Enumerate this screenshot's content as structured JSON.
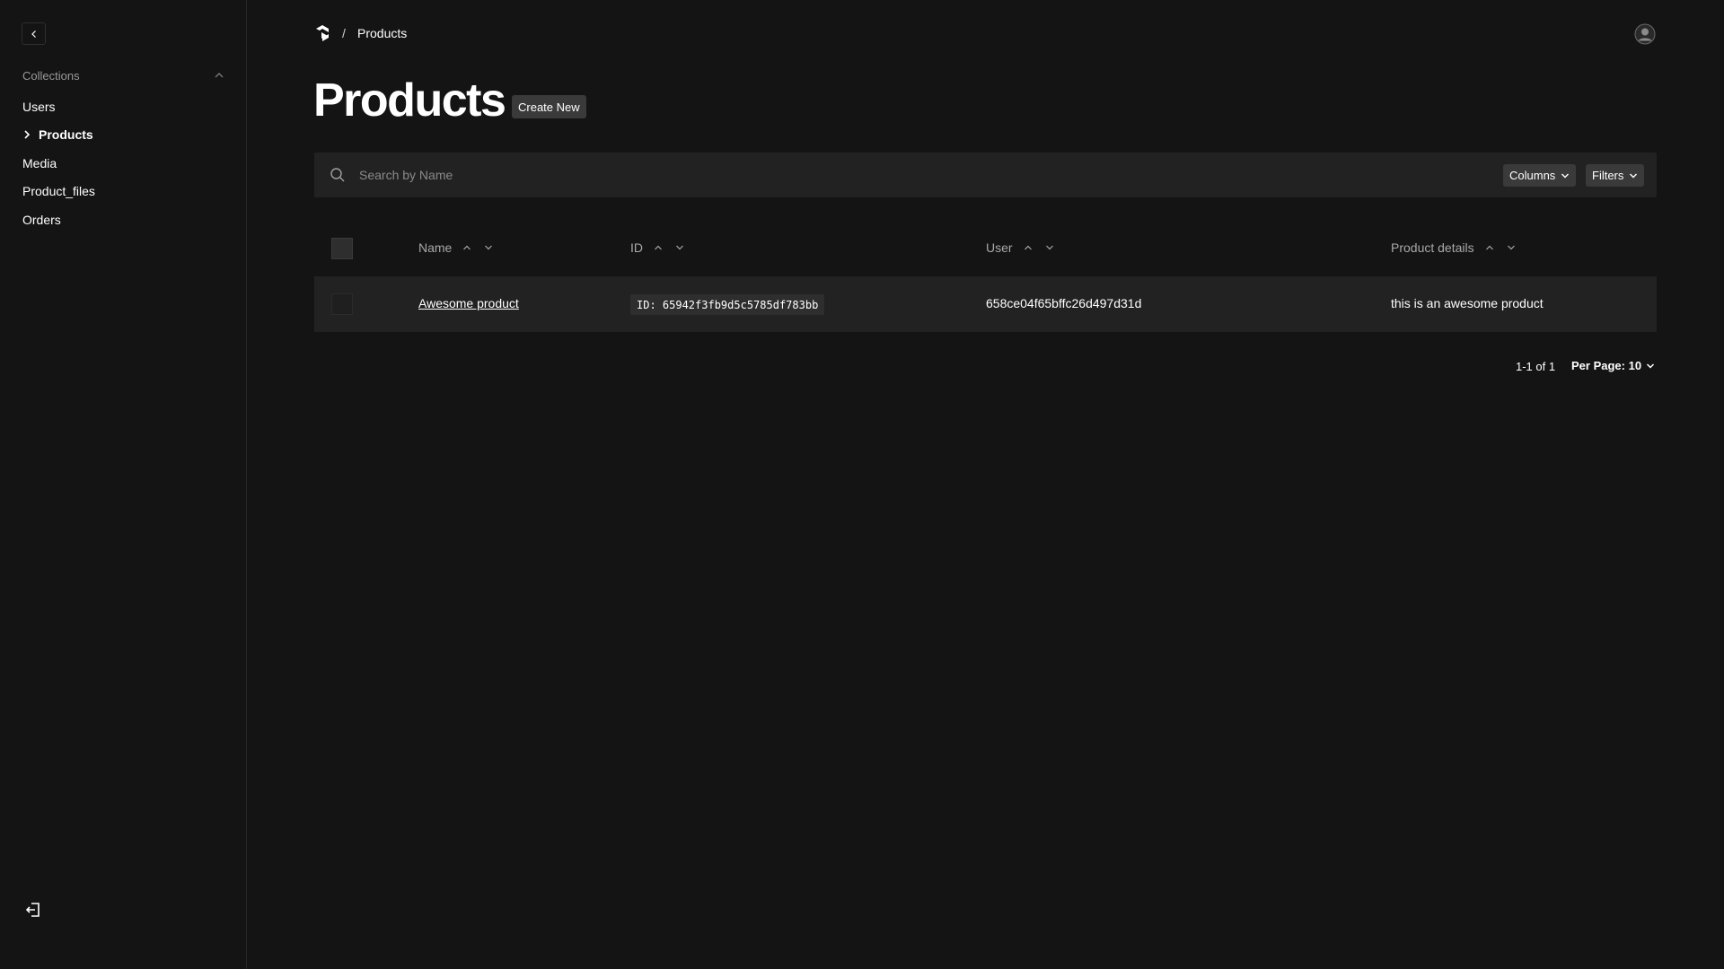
{
  "sidebar": {
    "section_label": "Collections",
    "items": [
      {
        "label": "Users"
      },
      {
        "label": "Products"
      },
      {
        "label": "Media"
      },
      {
        "label": "Product_files"
      },
      {
        "label": "Orders"
      }
    ],
    "active_item": "Products"
  },
  "breadcrumb": {
    "separator": "/",
    "current": "Products"
  },
  "page": {
    "title": "Products",
    "create_label": "Create New"
  },
  "search": {
    "placeholder": "Search by Name",
    "value": ""
  },
  "controls": {
    "columns_label": "Columns",
    "filters_label": "Filters"
  },
  "table": {
    "columns": [
      "Name",
      "ID",
      "User",
      "Product details"
    ],
    "rows": [
      {
        "name": "Awesome product",
        "id": "ID: 65942f3fb9d5c5785df783bb",
        "user": "658ce04f65bffc26d497d31d",
        "details": "this is an awesome product"
      }
    ]
  },
  "pagination": {
    "count_text": "1-1 of 1",
    "per_page_text": "Per Page: 10"
  },
  "icons": {
    "collapse": "chevron-left-icon",
    "section_toggle": "chevron-up-icon",
    "active_marker": "chevron-right-icon",
    "logout": "logout-icon",
    "logo": "payload-logo-icon",
    "avatar": "user-avatar-icon",
    "search": "search-icon"
  }
}
